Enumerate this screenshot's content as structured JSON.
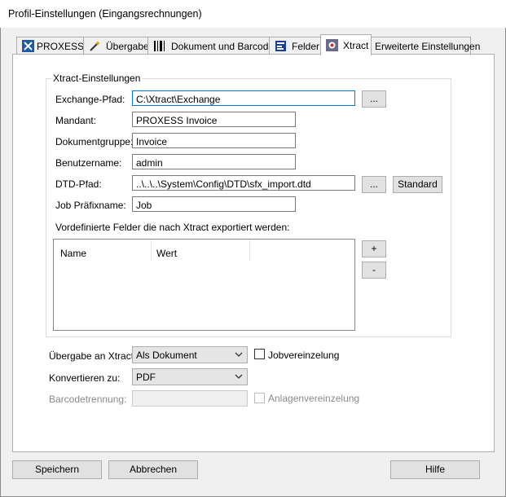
{
  "window": {
    "title": "Profil-Einstellungen (Eingangsrechnungen)"
  },
  "tabs": [
    {
      "label": "PROXESS",
      "icon": "proxess-icon"
    },
    {
      "label": "Übergabe",
      "icon": "wand-icon"
    },
    {
      "label": "Dokument und Barcode",
      "icon": "barcode-icon"
    },
    {
      "label": "Felder",
      "icon": "fields-icon"
    },
    {
      "label": "Xtract",
      "icon": "xtract-icon",
      "active": true
    },
    {
      "label": "Erweiterte Einstellungen"
    }
  ],
  "xtract": {
    "group_title": "Xtract-Einstellungen",
    "exchange_label": "Exchange-Pfad:",
    "exchange_value": "C:\\Xtract\\Exchange",
    "browse1": "...",
    "mandant_label": "Mandant:",
    "mandant_value": "PROXESS Invoice",
    "dokgruppe_label": "Dokumentgruppe:",
    "dokgruppe_value": "Invoice",
    "benutzer_label": "Benutzername:",
    "benutzer_value": "admin",
    "dtd_label": "DTD-Pfad:",
    "dtd_value": "..\\..\\..\\System\\Config\\DTD\\sfx_import.dtd",
    "browse2": "...",
    "standard_button": "Standard",
    "job_label": "Job Präfixname:",
    "job_value": "Job",
    "fields_caption": "Vordefinierte Felder die nach Xtract exportiert werden:",
    "col_name": "Name",
    "col_wert": "Wert",
    "add_button": "+",
    "remove_button": "-"
  },
  "bottom": {
    "uebergabe_label": "Übergabe an Xtract:",
    "uebergabe_value": "Als Dokument",
    "jobvereinzelung_label": "Jobvereinzelung",
    "konvertieren_label": "Konvertieren zu:",
    "konvertieren_value": "PDF",
    "barcode_label": "Barcodetrennung:",
    "barcode_value": "",
    "anlagen_label": "Anlagenvereinzelung"
  },
  "footer": {
    "save": "Speichern",
    "cancel": "Abbrechen",
    "help": "Hilfe"
  }
}
